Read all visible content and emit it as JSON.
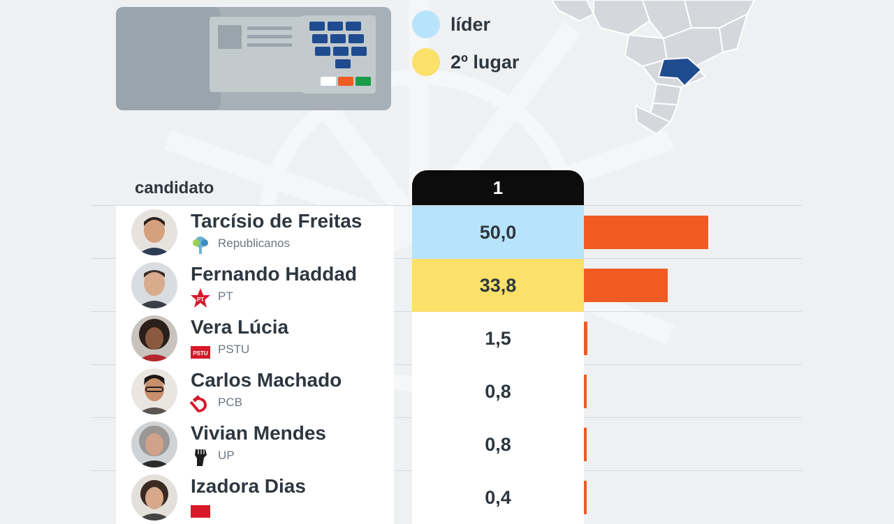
{
  "colors": {
    "leader": "#b8e4fb",
    "second": "#fbe06a",
    "bar": "#f05a23",
    "map_highlight": "#1f4b8f",
    "round_header_bg": "#0c0c0c"
  },
  "legend": [
    {
      "label": "líder",
      "color": "#b8e4fb"
    },
    {
      "label": "2º lugar",
      "color": "#fbe06a"
    }
  ],
  "table": {
    "candidate_header": "candidato",
    "round_header": "1"
  },
  "chart_data": {
    "type": "bar",
    "categories": [
      "Tarcísio de Freitas",
      "Fernando Haddad",
      "Vera Lúcia",
      "Carlos Machado",
      "Vivian Mendes",
      "Izadora Dias"
    ],
    "values": [
      50.0,
      33.8,
      1.5,
      0.8,
      0.8,
      0.4
    ],
    "value_labels": [
      "50,0",
      "33,8",
      "1,5",
      "0,8",
      "0,8",
      "0,4"
    ],
    "xlim": [
      0,
      100
    ]
  },
  "rows": [
    {
      "name": "Tarcísio de Freitas",
      "party": "Republicanos",
      "party_icon": "republicanos-tree-icon",
      "value_label": "50,0",
      "highlight": "leader"
    },
    {
      "name": "Fernando Haddad",
      "party": "PT",
      "party_icon": "pt-star-icon",
      "value_label": "33,8",
      "highlight": "second"
    },
    {
      "name": "Vera Lúcia",
      "party": "PSTU",
      "party_icon": "pstu-flag-icon",
      "value_label": "1,5",
      "highlight": ""
    },
    {
      "name": "Carlos Machado",
      "party": "PCB",
      "party_icon": "hammer-sickle-icon",
      "value_label": "0,8",
      "highlight": ""
    },
    {
      "name": "Vivian Mendes",
      "party": "UP",
      "party_icon": "raised-fist-icon",
      "value_label": "0,8",
      "highlight": ""
    },
    {
      "name": "Izadora Dias",
      "party": "",
      "party_icon": "party-flag-icon",
      "value_label": "0,4",
      "highlight": ""
    }
  ]
}
